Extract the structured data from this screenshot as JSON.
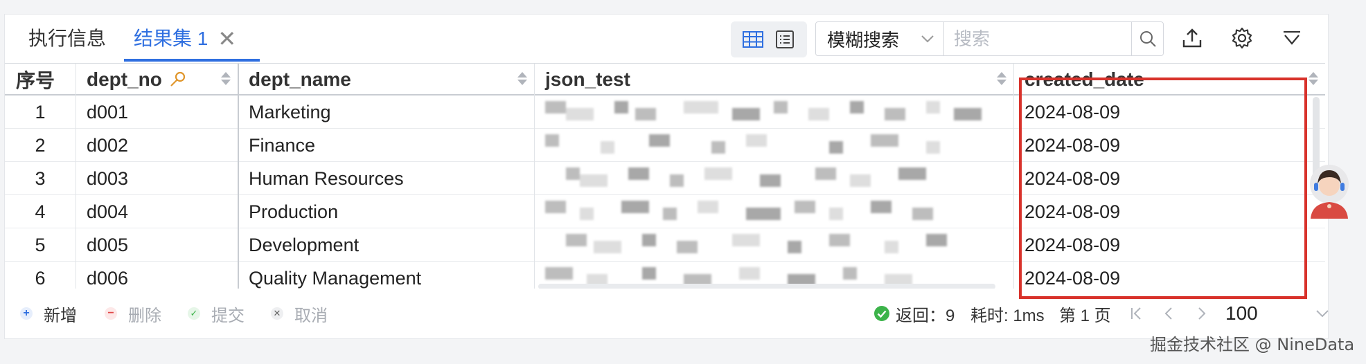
{
  "tabs": {
    "exec_info": "执行信息",
    "result_set": "结果集 1",
    "close_glyph": "✕"
  },
  "toolbar": {
    "search_mode": "模糊搜索",
    "search_placeholder": "搜索",
    "icons": [
      "grid-view-icon",
      "list-view-icon",
      "search-icon",
      "export-icon",
      "settings-icon",
      "filter-icon"
    ]
  },
  "table": {
    "columns": [
      "序号",
      "dept_no",
      "dept_name",
      "json_test",
      "created_date"
    ],
    "rows": [
      {
        "seq": "1",
        "dept_no": "d001",
        "dept_name": "Marketing",
        "created_date": "2024-08-09"
      },
      {
        "seq": "2",
        "dept_no": "d002",
        "dept_name": "Finance",
        "created_date": "2024-08-09"
      },
      {
        "seq": "3",
        "dept_no": "d003",
        "dept_name": "Human Resources",
        "created_date": "2024-08-09"
      },
      {
        "seq": "4",
        "dept_no": "d004",
        "dept_name": "Production",
        "created_date": "2024-08-09"
      },
      {
        "seq": "5",
        "dept_no": "d005",
        "dept_name": "Development",
        "created_date": "2024-08-09"
      },
      {
        "seq": "6",
        "dept_no": "d006",
        "dept_name": "Quality Management",
        "created_date": "2024-08-09"
      }
    ],
    "highlight_color": "#d8322b"
  },
  "footer": {
    "add": "新增",
    "delete": "删除",
    "submit": "提交",
    "cancel": "取消",
    "returned": "返回：9",
    "elapsed": "耗时: 1ms",
    "page": "第 1 页",
    "page_size": "100"
  },
  "watermark": "掘金技术社区 @ NineData",
  "colors": {
    "accent": "#2f6fe0",
    "success": "#3cb34a",
    "danger": "#e04848"
  }
}
